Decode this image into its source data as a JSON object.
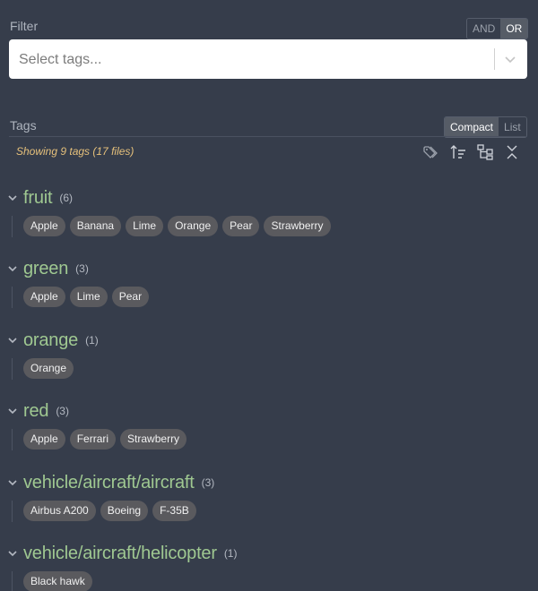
{
  "filter": {
    "label": "Filter",
    "and_label": "AND",
    "or_label": "OR",
    "placeholder": "Select tags..."
  },
  "tags_panel": {
    "label": "Tags",
    "compact_label": "Compact",
    "list_label": "List",
    "showing_text": "Showing 9 tags (17 files)"
  },
  "toolbar": {
    "icons": [
      "tags-icon",
      "sort-icon",
      "hierarchy-icon",
      "collapse-all-icon"
    ]
  },
  "groups": [
    {
      "name": "fruit",
      "count": "(6)",
      "chips": [
        "Apple",
        "Banana",
        "Lime",
        "Orange",
        "Pear",
        "Strawberry"
      ]
    },
    {
      "name": "green",
      "count": "(3)",
      "chips": [
        "Apple",
        "Lime",
        "Pear"
      ]
    },
    {
      "name": "orange",
      "count": "(1)",
      "chips": [
        "Orange"
      ]
    },
    {
      "name": "red",
      "count": "(3)",
      "chips": [
        "Apple",
        "Ferrari",
        "Strawberry"
      ]
    },
    {
      "name": "vehicle/aircraft/aircraft",
      "count": "(3)",
      "chips": [
        "Airbus A200",
        "Boeing",
        "F-35B"
      ]
    },
    {
      "name": "vehicle/aircraft/helicopter",
      "count": "(1)",
      "chips": [
        "Black hawk"
      ]
    }
  ],
  "colors": {
    "background": "#363d4b",
    "tag_name": "#9fc891",
    "showing": "#e5c07b",
    "chip_bg": "#5a5a5e"
  }
}
